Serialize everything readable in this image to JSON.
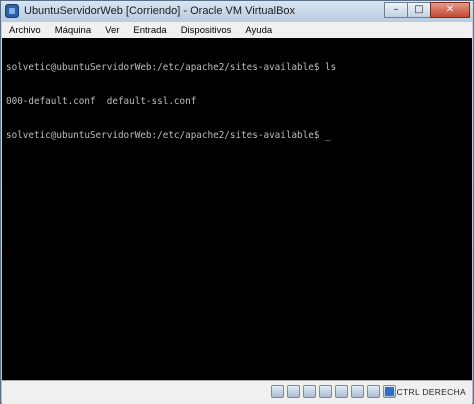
{
  "window": {
    "title": "UbuntuServidorWeb [Corriendo] - Oracle VM VirtualBox",
    "minimize_label": "–",
    "restore_label": "□",
    "close_label": "✕"
  },
  "menu": {
    "items": [
      {
        "label": "Archivo"
      },
      {
        "label": "Máquina"
      },
      {
        "label": "Ver"
      },
      {
        "label": "Entrada"
      },
      {
        "label": "Dispositivos"
      },
      {
        "label": "Ayuda"
      }
    ]
  },
  "terminal": {
    "lines": [
      "solvetic@ubuntuServidorWeb:/etc/apache2/sites-available$ ls",
      "000-default.conf  default-ssl.conf",
      "solvetic@ubuntuServidorWeb:/etc/apache2/sites-available$ "
    ],
    "cursor": "_"
  },
  "statusbar": {
    "icons": [
      "hard-disk-icon",
      "optical-drive-icon",
      "usb-icon",
      "network-icon",
      "shared-folder-icon",
      "display-icon",
      "video-capture-icon",
      "mouse-integration-icon"
    ],
    "host_key": "CTRL DERECHA"
  }
}
